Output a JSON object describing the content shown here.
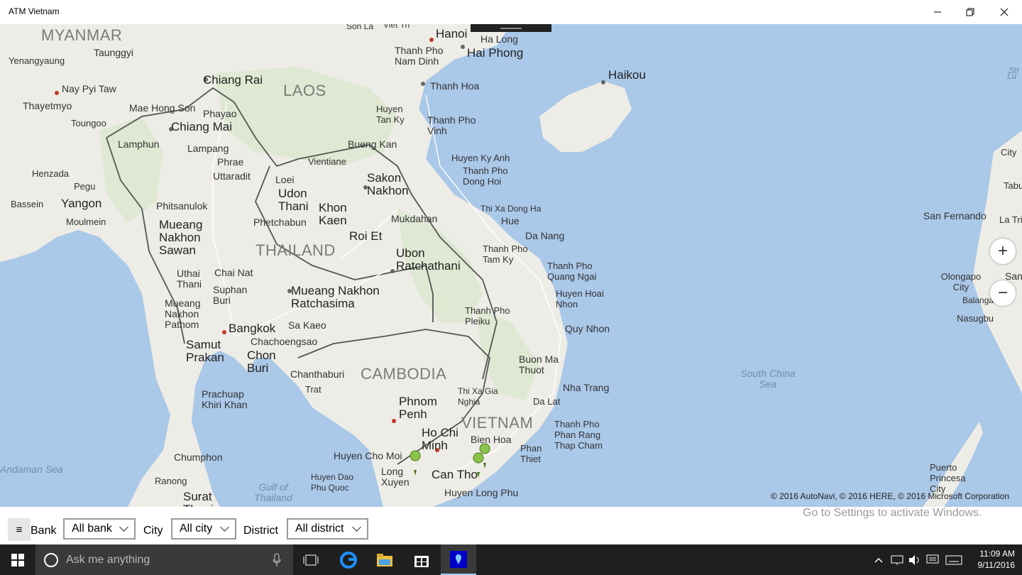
{
  "window": {
    "title": "ATM Vietnam",
    "minimize_icon": "minimize-icon",
    "maximize_icon": "restore-icon",
    "close_icon": "close-icon"
  },
  "map": {
    "countries": [
      "MYANMAR",
      "LAOS",
      "THAILAND",
      "CAMBODIA",
      "VIETNAM"
    ],
    "seas": [
      "Gulf of Thailand",
      "South China Sea",
      "Andaman Sea"
    ],
    "cities": [
      "Hanoi",
      "Hai Phong",
      "Ha Long",
      "Son La",
      "Viet Tri",
      "Thanh Pho Nam Dinh",
      "Thanh Hoa",
      "Haikou",
      "Taunggyi",
      "Yenangyaung",
      "Nay Pyi Taw",
      "Thayetmyo",
      "Toungoo",
      "Chiang Rai",
      "Mae Hong Son",
      "Phayao",
      "Chiang Mai",
      "Lamphun",
      "Lampang",
      "Phrae",
      "Uttaradit",
      "Huyen Tan Ky",
      "Thanh Pho Vinh",
      "Bueng Kan",
      "Vientiane",
      "Loei",
      "Udon Thani",
      "Khon Kaen",
      "Sakon Nakhon",
      "Henzada",
      "Pegu",
      "Bassein",
      "Yangon",
      "Moulmein",
      "Phitsanulok",
      "Mueang Nakhon Sawan",
      "Phetchabun",
      "Roi Et",
      "Mukdahan",
      "Huyen Ky Anh",
      "Thanh Pho Dong Hoi",
      "Thi Xa Dong Ha",
      "Hue",
      "Da Nang",
      "Thanh Pho Tam Ky",
      "Thanh Pho Quang Ngai",
      "Uthai Thani",
      "Chai Nat",
      "Suphan Buri",
      "Mueang Nakhon Ratchasima",
      "Ubon Ratchathani",
      "Huyen Hoai Nhon",
      "Mueang Nakhon Pathom",
      "Bangkok",
      "Sa Kaeo",
      "Chachoengsao",
      "Chon Buri",
      "Thanh Pho Pleiku",
      "Quy Nhon",
      "Samut Prakan",
      "Chanthaburi",
      "Trat",
      "Buon Ma Thuot",
      "Nha Trang",
      "Thi Xa Gia Nghia",
      "Da Lat",
      "Prachuap Khiri Khan",
      "Phnom Penh",
      "Ho Chi Minh",
      "Bien Hoa",
      "Thanh Pho Phan Rang Thap Cham",
      "Phan Thiet",
      "Chumphon",
      "Huyen Cho Moi",
      "Long Xuyen",
      "Can Tho",
      "Huyen Dao Phu Quoc",
      "Huyen Long Phu",
      "Ranong",
      "Surat Thani",
      "San Fernando",
      "Olongapo City",
      "Balanga",
      "Nasugbu",
      "Puerto Princesa City",
      "La Tri",
      "Lu",
      "Str",
      "City",
      "Tabu",
      "San"
    ],
    "copyright": "© 2016 AutoNavi, © 2016 HERE, © 2016 Microsoft Corporation",
    "zoom_in_icon": "plus-icon",
    "zoom_out_icon": "minus-icon"
  },
  "filters": {
    "menu_icon": "hamburger-icon",
    "menu_glyph": "≡",
    "bank_label": "Bank",
    "bank_value": "All bank",
    "city_label": "City",
    "city_value": "All city",
    "district_label": "District",
    "district_value": "All district"
  },
  "watermark": "Go to Settings to activate Windows.",
  "taskbar": {
    "search_placeholder": "Ask me anything",
    "time": "11:09 AM",
    "date": "9/11/2016"
  }
}
